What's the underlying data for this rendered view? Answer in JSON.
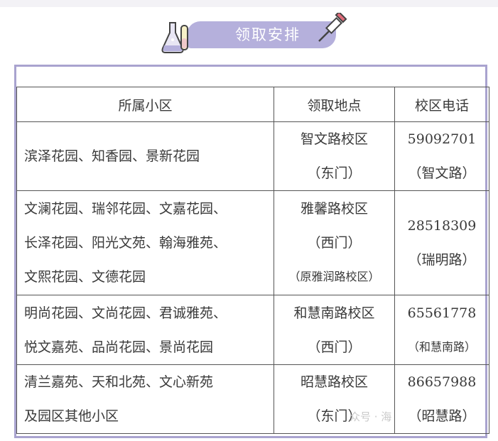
{
  "header": {
    "title": "领取安排"
  },
  "table": {
    "headers": [
      "所属小区",
      "领取地点",
      "校区电话"
    ],
    "rows": [
      {
        "areas": [
          "滨泽花园、知香园、景新花园"
        ],
        "location": [
          "智文路校区",
          "（东门）"
        ],
        "phone": "59092701",
        "phone_note": "（智文路）"
      },
      {
        "areas": [
          "文澜花园、瑞邻花园、文嘉花园、",
          "长泽花园、阳光文苑、翰海雅苑、",
          "文熙花园、文德花园"
        ],
        "location": [
          "雅馨路校区",
          "（西门）",
          "（原雅润路校区）"
        ],
        "phone": "28518309",
        "phone_note": "（瑞明路）"
      },
      {
        "areas": [
          "明尚花园、文尚花园、君诚雅苑、",
          "悦文嘉苑、品尚花园、景尚花园"
        ],
        "location": [
          "和慧南路校区",
          "（西门）"
        ],
        "phone": "65561778",
        "phone_note": "（和慧南路）"
      },
      {
        "areas": [
          "清兰嘉苑、天和北苑、文心新苑",
          "及园区其他小区"
        ],
        "location": [
          "昭慧路校区",
          "（东门）"
        ],
        "phone": "86657988",
        "phone_note": "（昭慧路）"
      }
    ]
  },
  "watermark": "众号 · 海",
  "colors": {
    "accent": "#b5b0dc",
    "frame": "#a9a3cf"
  }
}
